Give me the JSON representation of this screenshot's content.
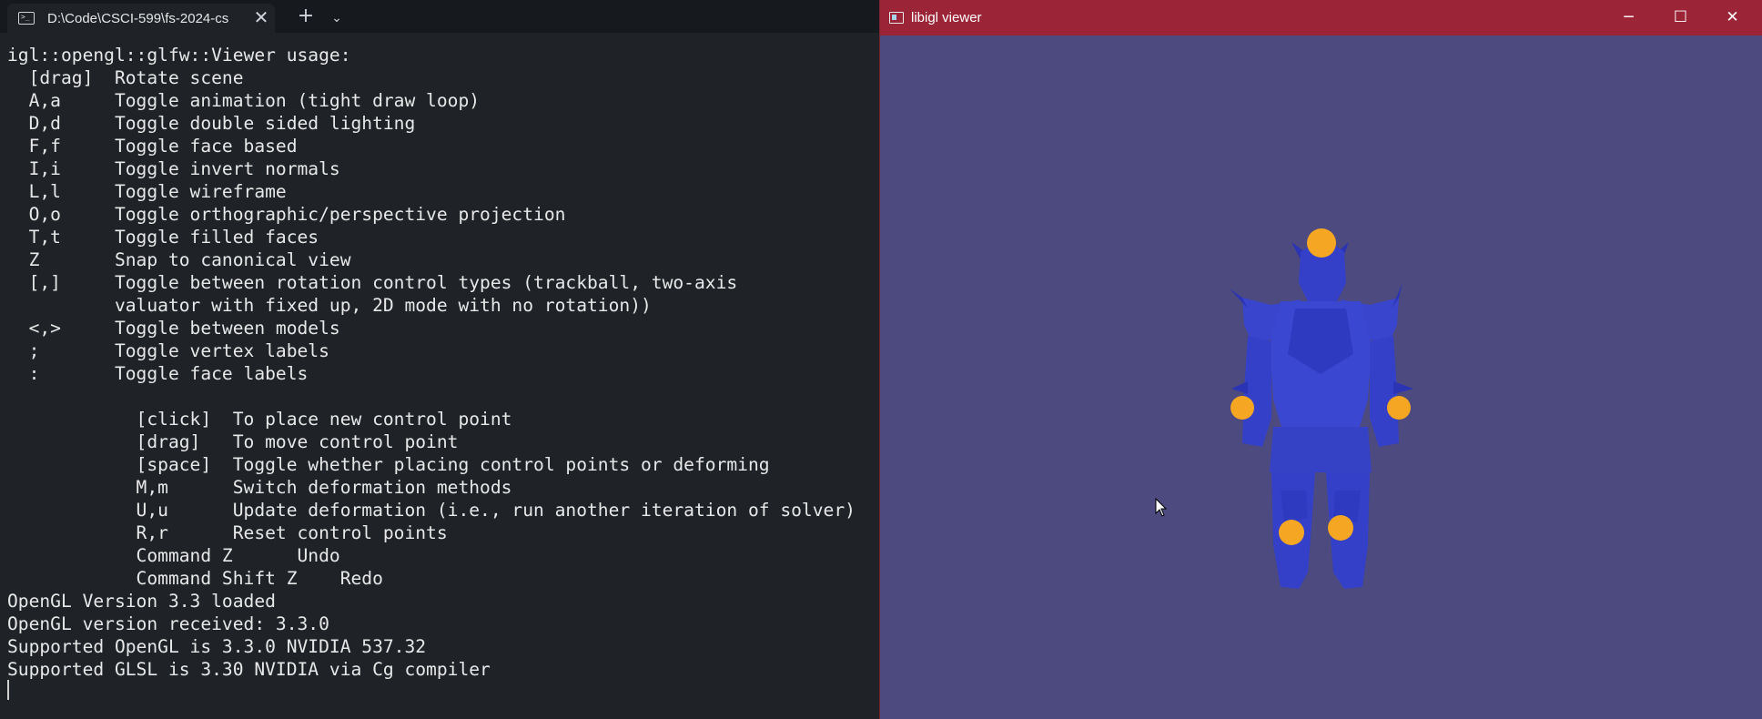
{
  "terminal": {
    "tab_title": "D:\\Code\\CSCI-599\\fs-2024-cs",
    "tab_icon": "terminal-icon",
    "close_glyph": "✕",
    "new_tab_glyph": "+",
    "dropdown_glyph": "⌄",
    "lines": [
      "igl::opengl::glfw::Viewer usage:",
      "  [drag]  Rotate scene",
      "  A,a     Toggle animation (tight draw loop)",
      "  D,d     Toggle double sided lighting",
      "  F,f     Toggle face based",
      "  I,i     Toggle invert normals",
      "  L,l     Toggle wireframe",
      "  O,o     Toggle orthographic/perspective projection",
      "  T,t     Toggle filled faces",
      "  Z       Snap to canonical view",
      "  [,]     Toggle between rotation control types (trackball, two-axis",
      "          valuator with fixed up, 2D mode with no rotation))",
      "  <,>     Toggle between models",
      "  ;       Toggle vertex labels",
      "  :       Toggle face labels",
      "",
      "            [click]  To place new control point",
      "            [drag]   To move control point",
      "            [space]  Toggle whether placing control points or deforming",
      "            M,m      Switch deformation methods",
      "            U,u      Update deformation (i.e., run another iteration of solver)",
      "            R,r      Reset control points",
      "            Command Z      Undo",
      "            Command Shift Z    Redo",
      "OpenGL Version 3.3 loaded",
      "OpenGL version received: 3.3.0",
      "Supported OpenGL is 3.3.0 NVIDIA 537.32",
      "Supported GLSL is 3.30 NVIDIA via Cg compiler"
    ]
  },
  "viewer": {
    "title": "libigl viewer",
    "minimize_glyph": "─",
    "maximize_glyph": "☐",
    "close_glyph": "✕",
    "background_color": "#4c4a7e",
    "titlebar_color": "#9b2436",
    "model_color": "#3540c8",
    "control_point_color": "#f5a623"
  }
}
